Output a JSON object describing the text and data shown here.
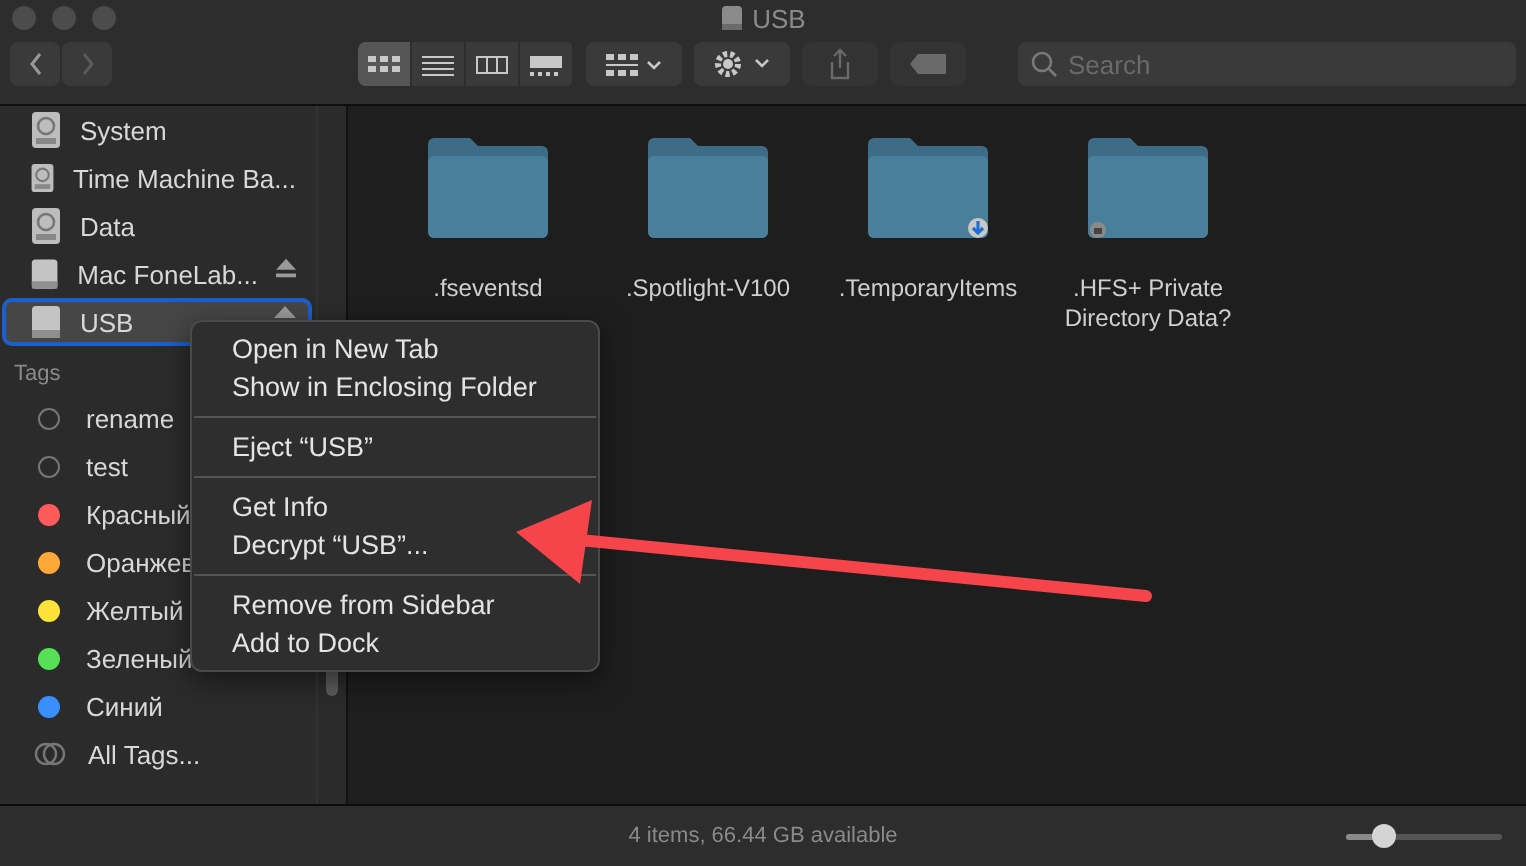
{
  "window": {
    "title": "USB"
  },
  "toolbar": {
    "views": [
      {
        "kind": "icons",
        "selected": true
      },
      {
        "kind": "list",
        "selected": false
      },
      {
        "kind": "columns",
        "selected": false
      },
      {
        "kind": "gallery",
        "selected": false
      }
    ],
    "search": {
      "placeholder": "Search"
    }
  },
  "sidebar": {
    "locations": [
      {
        "name": "System",
        "kind": "internal",
        "selected": false,
        "ejectable": false
      },
      {
        "name": "Time Machine Ba...",
        "kind": "internal",
        "selected": false,
        "ejectable": false
      },
      {
        "name": "Data",
        "kind": "internal",
        "selected": false,
        "ejectable": false
      },
      {
        "name": "Mac FoneLab...",
        "kind": "external",
        "selected": false,
        "ejectable": true
      },
      {
        "name": "USB",
        "kind": "external",
        "selected": true,
        "ejectable": true
      }
    ],
    "tags_header": "Tags",
    "tags": [
      {
        "name": "rename"
      },
      {
        "name": "test"
      },
      {
        "name": "Красный",
        "color": "#fe5a5a"
      },
      {
        "name": "Оранжев",
        "color": "#fea83a"
      },
      {
        "name": "Желтый",
        "color": "#fde23a"
      },
      {
        "name": "Зеленый",
        "color": "#56e056"
      },
      {
        "name": "Синий",
        "color": "#3a8ffe"
      },
      {
        "name": "All Tags...",
        "kind": "all"
      }
    ]
  },
  "files": [
    {
      "name": ".fseventsd",
      "downloading": false,
      "locked": false
    },
    {
      "name": ".Spotlight-V100",
      "downloading": false,
      "locked": false
    },
    {
      "name": ".TemporaryItems",
      "downloading": true,
      "locked": false
    },
    {
      "name": ".HFS+ Private Directory Data?",
      "downloading": false,
      "locked": true
    }
  ],
  "context_menu": {
    "groups": [
      [
        "Open in New Tab",
        "Show in Enclosing Folder"
      ],
      [
        "Eject “USB”"
      ],
      [
        "Get Info",
        "Decrypt “USB”..."
      ],
      [
        "Remove from Sidebar",
        "Add to Dock"
      ]
    ]
  },
  "status_bar": {
    "text": "4 items, 66.44 GB available",
    "zoom": {
      "level": 0.24
    }
  }
}
